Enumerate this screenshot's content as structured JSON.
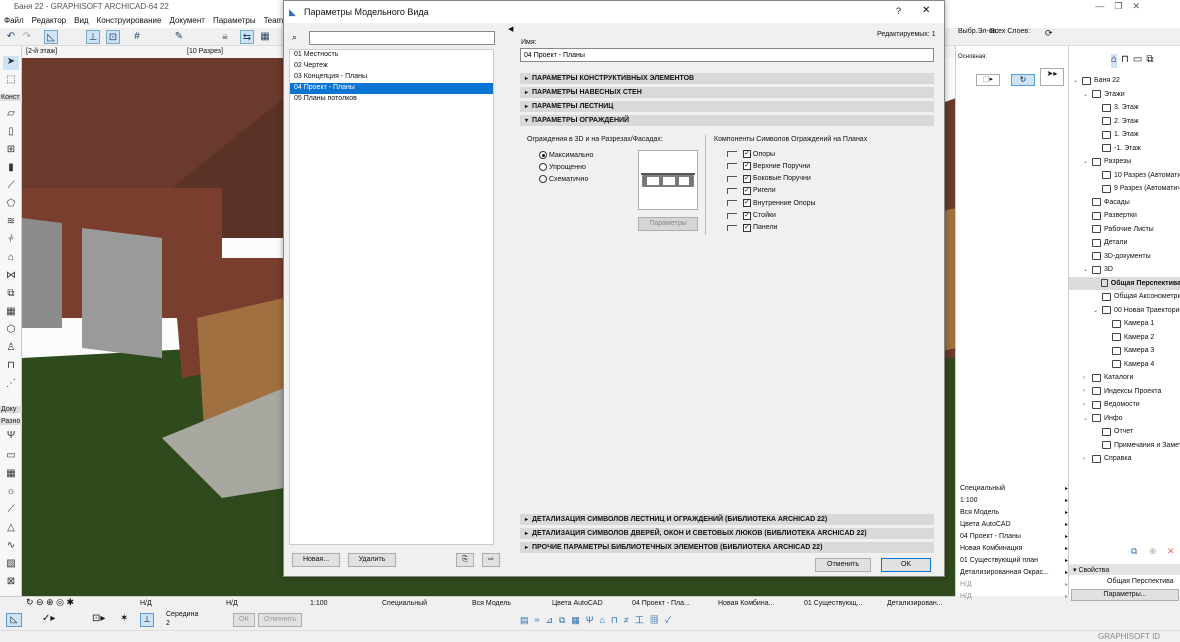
{
  "app": {
    "title": "Баня 22 - GRAPHISOFT ARCHICAD-64 22",
    "menu": [
      "Файл",
      "Редактор",
      "Вид",
      "Конструирование",
      "Документ",
      "Параметры",
      "Teamwork"
    ],
    "tabs": [
      "[2-й этаж]",
      "[10 Разрез]"
    ],
    "toolbox_groups": [
      "Конст",
      "Доку",
      "Разно"
    ],
    "sel_label": "Выбр.Эл-ов:",
    "layers_label": "Всех Слоев:",
    "main_label": "Основная:"
  },
  "navigator": {
    "items": [
      {
        "label": "Баня 22",
        "level": 0,
        "expanded": true
      },
      {
        "label": "Этажи",
        "level": 1,
        "expanded": true
      },
      {
        "label": "3. Этаж",
        "level": 2
      },
      {
        "label": "2. Этаж",
        "level": 2
      },
      {
        "label": "1. Этаж",
        "level": 2
      },
      {
        "label": "-1. Этаж",
        "level": 2
      },
      {
        "label": "Разрезы",
        "level": 1,
        "expanded": true
      },
      {
        "label": "10 Разрез (Автоматич",
        "level": 2
      },
      {
        "label": "9 Разрез (Автоматиче",
        "level": 2
      },
      {
        "label": "Фасады",
        "level": 1
      },
      {
        "label": "Развертки",
        "level": 1
      },
      {
        "label": "Рабочие Листы",
        "level": 1
      },
      {
        "label": "Детали",
        "level": 1
      },
      {
        "label": "3D-документы",
        "level": 1
      },
      {
        "label": "3D",
        "level": 1,
        "expanded": true
      },
      {
        "label": "Общая Перспектива",
        "level": 2,
        "selected": true
      },
      {
        "label": "Общая Аксонометрия",
        "level": 2
      },
      {
        "label": "00 Новая Траектория",
        "level": 2,
        "expanded": true
      },
      {
        "label": "Камера 1",
        "level": 3
      },
      {
        "label": "Камера 2",
        "level": 3
      },
      {
        "label": "Камера 3",
        "level": 3
      },
      {
        "label": "Камера 4",
        "level": 3
      },
      {
        "label": "Каталоги",
        "level": 1,
        "collapsed": true
      },
      {
        "label": "Индексы Проекта",
        "level": 1,
        "collapsed": true
      },
      {
        "label": "Ведомости",
        "level": 1,
        "collapsed": true
      },
      {
        "label": "Инфо",
        "level": 1,
        "expanded": true
      },
      {
        "label": "Отчет",
        "level": 2
      },
      {
        "label": "Примечания и Замет",
        "level": 2
      },
      {
        "label": "Справка",
        "level": 1,
        "collapsed": true
      }
    ],
    "properties_label": "Свойства",
    "properties_value": "Общая Перспектива",
    "params_button": "Параметры..."
  },
  "popup": {
    "items": [
      "Специальный",
      "1:100",
      "Вся Модель",
      "Цвета AutoCAD",
      "04 Проект - Планы",
      "Новая Комбинация",
      "01 Существующий план",
      "Детализированная Окрас...",
      "Н/Д",
      "Н/Д"
    ]
  },
  "statusbar": {
    "nd1": "Н/Д",
    "nd2": "Н/Д",
    "scale": "1:100",
    "pen": "Специальный",
    "model": "Вся Модель",
    "colors": "Цвета AutoCAD",
    "mvo": "04 Проект - Пла...",
    "combo": "Новая Комбина...",
    "renov": "01 Существующ...",
    "detail": "Детализирован..."
  },
  "snapbar": {
    "mode": "Середина",
    "value": "2",
    "ok": "OK",
    "cancel": "Отменить"
  },
  "brand": "GRAPHISOFT ID",
  "dialog": {
    "title": "Параметры Модельного Вида",
    "help": "?",
    "close": "✕",
    "search_placeholder": "",
    "list": [
      "01 Местность",
      "02 Чертеж",
      "03 Концепция - Планы",
      "04 Проект - Планы",
      "05 Планы потолков"
    ],
    "selected_index": 3,
    "new_button": "Новая...",
    "delete_button": "Удалить",
    "editable": "Редактируемых: 1",
    "name_label": "Имя:",
    "name_value": "04 Проект - Планы",
    "sections_top": [
      "ПАРАМЕТРЫ КОНСТРУКТИВНЫХ ЭЛЕМЕНТОВ",
      "ПАРАМЕТРЫ НАВЕСНЫХ СТЕН",
      "ПАРАМЕТРЫ ЛЕСТНИЦ",
      "ПАРАМЕТРЫ ОГРАЖДЕНИЙ"
    ],
    "railing": {
      "group3d_label": "Ограждения в 3D и на Разрезах/Фасадах:",
      "options": [
        "Максимально",
        "Упрощенно",
        "Схематично"
      ],
      "selected_option": "Максимально",
      "params_button": "Параметры",
      "components_label": "Компоненты Символов Ограждений на Планах",
      "components": [
        {
          "label": "Опоры",
          "checked": true
        },
        {
          "label": "Верхние Поручни",
          "checked": true
        },
        {
          "label": "Боковые Поручни",
          "checked": true
        },
        {
          "label": "Ригели",
          "checked": true
        },
        {
          "label": "Внутренние Опоры",
          "checked": true
        },
        {
          "label": "Стойки",
          "checked": true
        },
        {
          "label": "Панели",
          "checked": true
        }
      ]
    },
    "sections_bottom": [
      "ДЕТАЛИЗАЦИЯ СИМВОЛОВ ЛЕСТНИЦ И ОГРАЖДЕНИЙ (БИБЛИОТЕКА ARCHICAD 22)",
      "ДЕТАЛИЗАЦИЯ СИМВОЛОВ ДВЕРЕЙ, ОКОН И СВЕТОВЫХ ЛЮКОВ (БИБЛИОТЕКА ARCHICAD 22)",
      "ПРОЧИЕ ПАРАМЕТРЫ БИБЛИОТЕЧНЫХ ЭЛЕМЕНТОВ (БИБЛИОТЕКА ARCHICAD 22)"
    ],
    "cancel_button": "Отменить",
    "ok_button": "OK"
  },
  "colors": {
    "selection": "#0a75d3",
    "grass": "#2f4a1c",
    "roof": "#6a3a2c",
    "brick": "#7a3e2e"
  }
}
